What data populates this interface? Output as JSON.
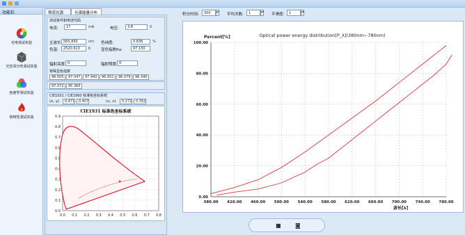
{
  "window": {
    "title": ""
  },
  "sidebar": {
    "header": "功能栏",
    "items": [
      {
        "label": "光电测试实验"
      },
      {
        "label": "光空间分布测试实验"
      },
      {
        "label": "色度学测试实验"
      },
      {
        "label": "热特性测试实验"
      }
    ]
  },
  "tabs": [
    {
      "label": "恒流光源"
    },
    {
      "label": "光谱能量分布"
    }
  ],
  "params": {
    "section_title": "测试条件和电流代码",
    "current_label": "电流:",
    "current_value": "17",
    "current_unit": "mA",
    "voltage_label": "电压:",
    "voltage_value": "3.8",
    "voltage_unit": "V",
    "peak_label": "主波长:",
    "peak_value": "565.893",
    "peak_unit": "nm",
    "purity_label": "色纯度:",
    "purity_value": "0.836",
    "purity_unit": "%",
    "cct_label": "色温:",
    "cct_value": "2520.613",
    "cct_unit": "K",
    "cri_label": "显色指数Ra:",
    "cri_value": "97.130",
    "temp_label": "辐射亮度:",
    "temp_value": "0",
    "temp2_label": "辐射照度:",
    "temp2_value": "0"
  },
  "special_cri": {
    "title": "特殊显色指数",
    "values": [
      "96.505",
      "97.047",
      "97.942",
      "96.831",
      "96.079",
      "96.340",
      "97.072",
      "95.365"
    ]
  },
  "chroma_coords": {
    "title": "CIE1931 / CIE1960 标准色坐标系统",
    "x_label": "(x, y)",
    "x_value": "0.471",
    "y_value": "0.407",
    "u_label": "(u, v)",
    "u_value": "0.272",
    "v_value": "0.352"
  },
  "cie_chart": {
    "title": "CIE1931 标准色坐标系统",
    "y_ticks": [
      "0.9",
      "0.8",
      "0.7",
      "0.6",
      "0.5",
      "0.4",
      "0.3",
      "0.2",
      "0.1",
      "0.0"
    ],
    "x_ticks": [
      "0.0",
      "0.1",
      "0.2",
      "0.3",
      "0.4",
      "0.5",
      "0.6",
      "0.7",
      "0.8"
    ]
  },
  "toolbar": {
    "integration_label": "积分时间:",
    "integration_value": "300",
    "average_label": "平均次数:",
    "average_value": "1",
    "smooth_label": "平滑度:",
    "smooth_value": "1"
  },
  "chart_data": {
    "type": "line",
    "title": "Optical power energy distribution[P_λ](380nm~780nm)",
    "ylabel": "Percent[%]",
    "xlabel": "波长[λ]",
    "xlim": [
      380,
      780
    ],
    "ylim": [
      0,
      100
    ],
    "x_ticks": [
      380,
      420,
      460,
      500,
      540,
      580,
      620,
      660,
      700,
      740,
      780
    ],
    "y_ticks": [
      0,
      20,
      40,
      60,
      80,
      100
    ],
    "grid": true,
    "series": [
      {
        "color": "#d9383b",
        "x": [
          380,
          420,
          460,
          500,
          540,
          580,
          620,
          660,
          700,
          740,
          780
        ],
        "y": [
          2,
          6,
          11,
          19,
          29,
          40,
          51,
          62,
          74,
          86,
          98
        ]
      },
      {
        "color": "#d9383b",
        "x": [
          390,
          420,
          460,
          500,
          540,
          560,
          580,
          600,
          620,
          640,
          660,
          680,
          700,
          720,
          740,
          760,
          780,
          790
        ],
        "y": [
          1,
          3,
          5,
          9,
          16,
          21,
          25,
          31,
          37,
          43,
          49,
          55,
          61,
          67,
          73,
          79,
          86,
          92
        ]
      }
    ]
  },
  "bottom": {
    "btn1": "■",
    "btn2": "◙"
  },
  "colors": {
    "accent": "#d9383b",
    "panel": "#d9e6f4",
    "border": "#9fbbdd"
  }
}
